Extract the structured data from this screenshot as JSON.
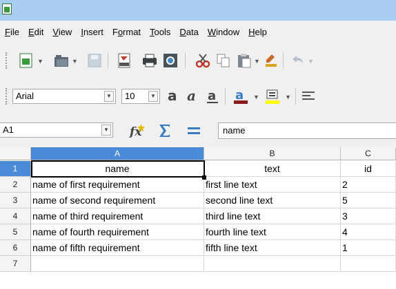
{
  "menu": [
    {
      "label": "File",
      "u": 0
    },
    {
      "label": "Edit",
      "u": 0
    },
    {
      "label": "View",
      "u": 0
    },
    {
      "label": "Insert",
      "u": 0
    },
    {
      "label": "Format",
      "u": 1
    },
    {
      "label": "Tools",
      "u": 0
    },
    {
      "label": "Data",
      "u": 0
    },
    {
      "label": "Window",
      "u": 0
    },
    {
      "label": "Help",
      "u": 0
    }
  ],
  "formatting": {
    "font_name": "Arial",
    "font_size": "10"
  },
  "formula_bar": {
    "name_box": "A1",
    "content": "name"
  },
  "columns": [
    "A",
    "B",
    "C"
  ],
  "rows": [
    "1",
    "2",
    "3",
    "4",
    "5",
    "6",
    "7"
  ],
  "cells": [
    [
      "name",
      "text",
      "id"
    ],
    [
      "name of first requirement",
      "first line text",
      "2"
    ],
    [
      "name of second requirement",
      "second line text",
      "5"
    ],
    [
      "name of third requirement",
      "third line text",
      "3"
    ],
    [
      "name of fourth requirement",
      "fourth line text",
      "4"
    ],
    [
      "name of fifth requirement",
      "fifth line text",
      "1"
    ],
    [
      "",
      "",
      ""
    ]
  ],
  "colors": {
    "titlebar": "#a9cdf1",
    "selected_header": "#4a8ad6",
    "font_color": "#8b1a1a",
    "highlight": "#ffff00"
  }
}
